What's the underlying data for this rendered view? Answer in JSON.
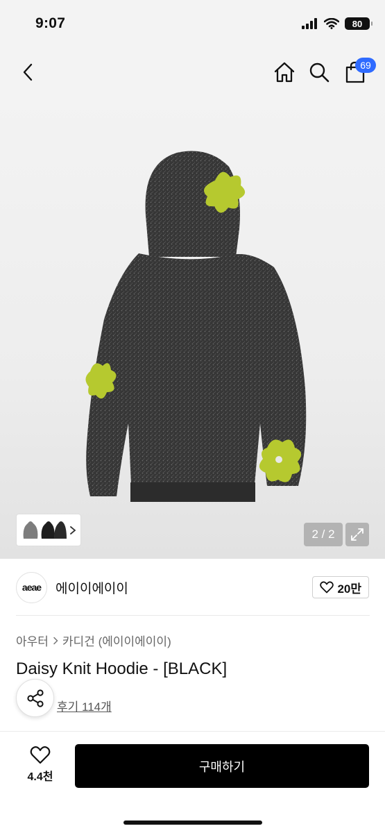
{
  "status_bar": {
    "time": "9:07",
    "battery": "80"
  },
  "nav": {
    "cart_count": "69"
  },
  "gallery": {
    "counter": "2 / 2"
  },
  "brand": {
    "logo_text": "aeae",
    "name": "에이이에이이",
    "likes": "20만"
  },
  "breadcrumb": {
    "category": "아우터",
    "subcategory": "카디건 (에이이에이이)"
  },
  "product": {
    "title": "Daisy Knit Hoodie - [BLACK]",
    "review_link": "후기 114개"
  },
  "bottom_bar": {
    "wish_count": "4.4천",
    "buy_label": "구매하기"
  },
  "colors": {
    "accent_badge": "#2f6bff",
    "hoodie": "#3a3a3a",
    "flower": "#b6c92f"
  }
}
